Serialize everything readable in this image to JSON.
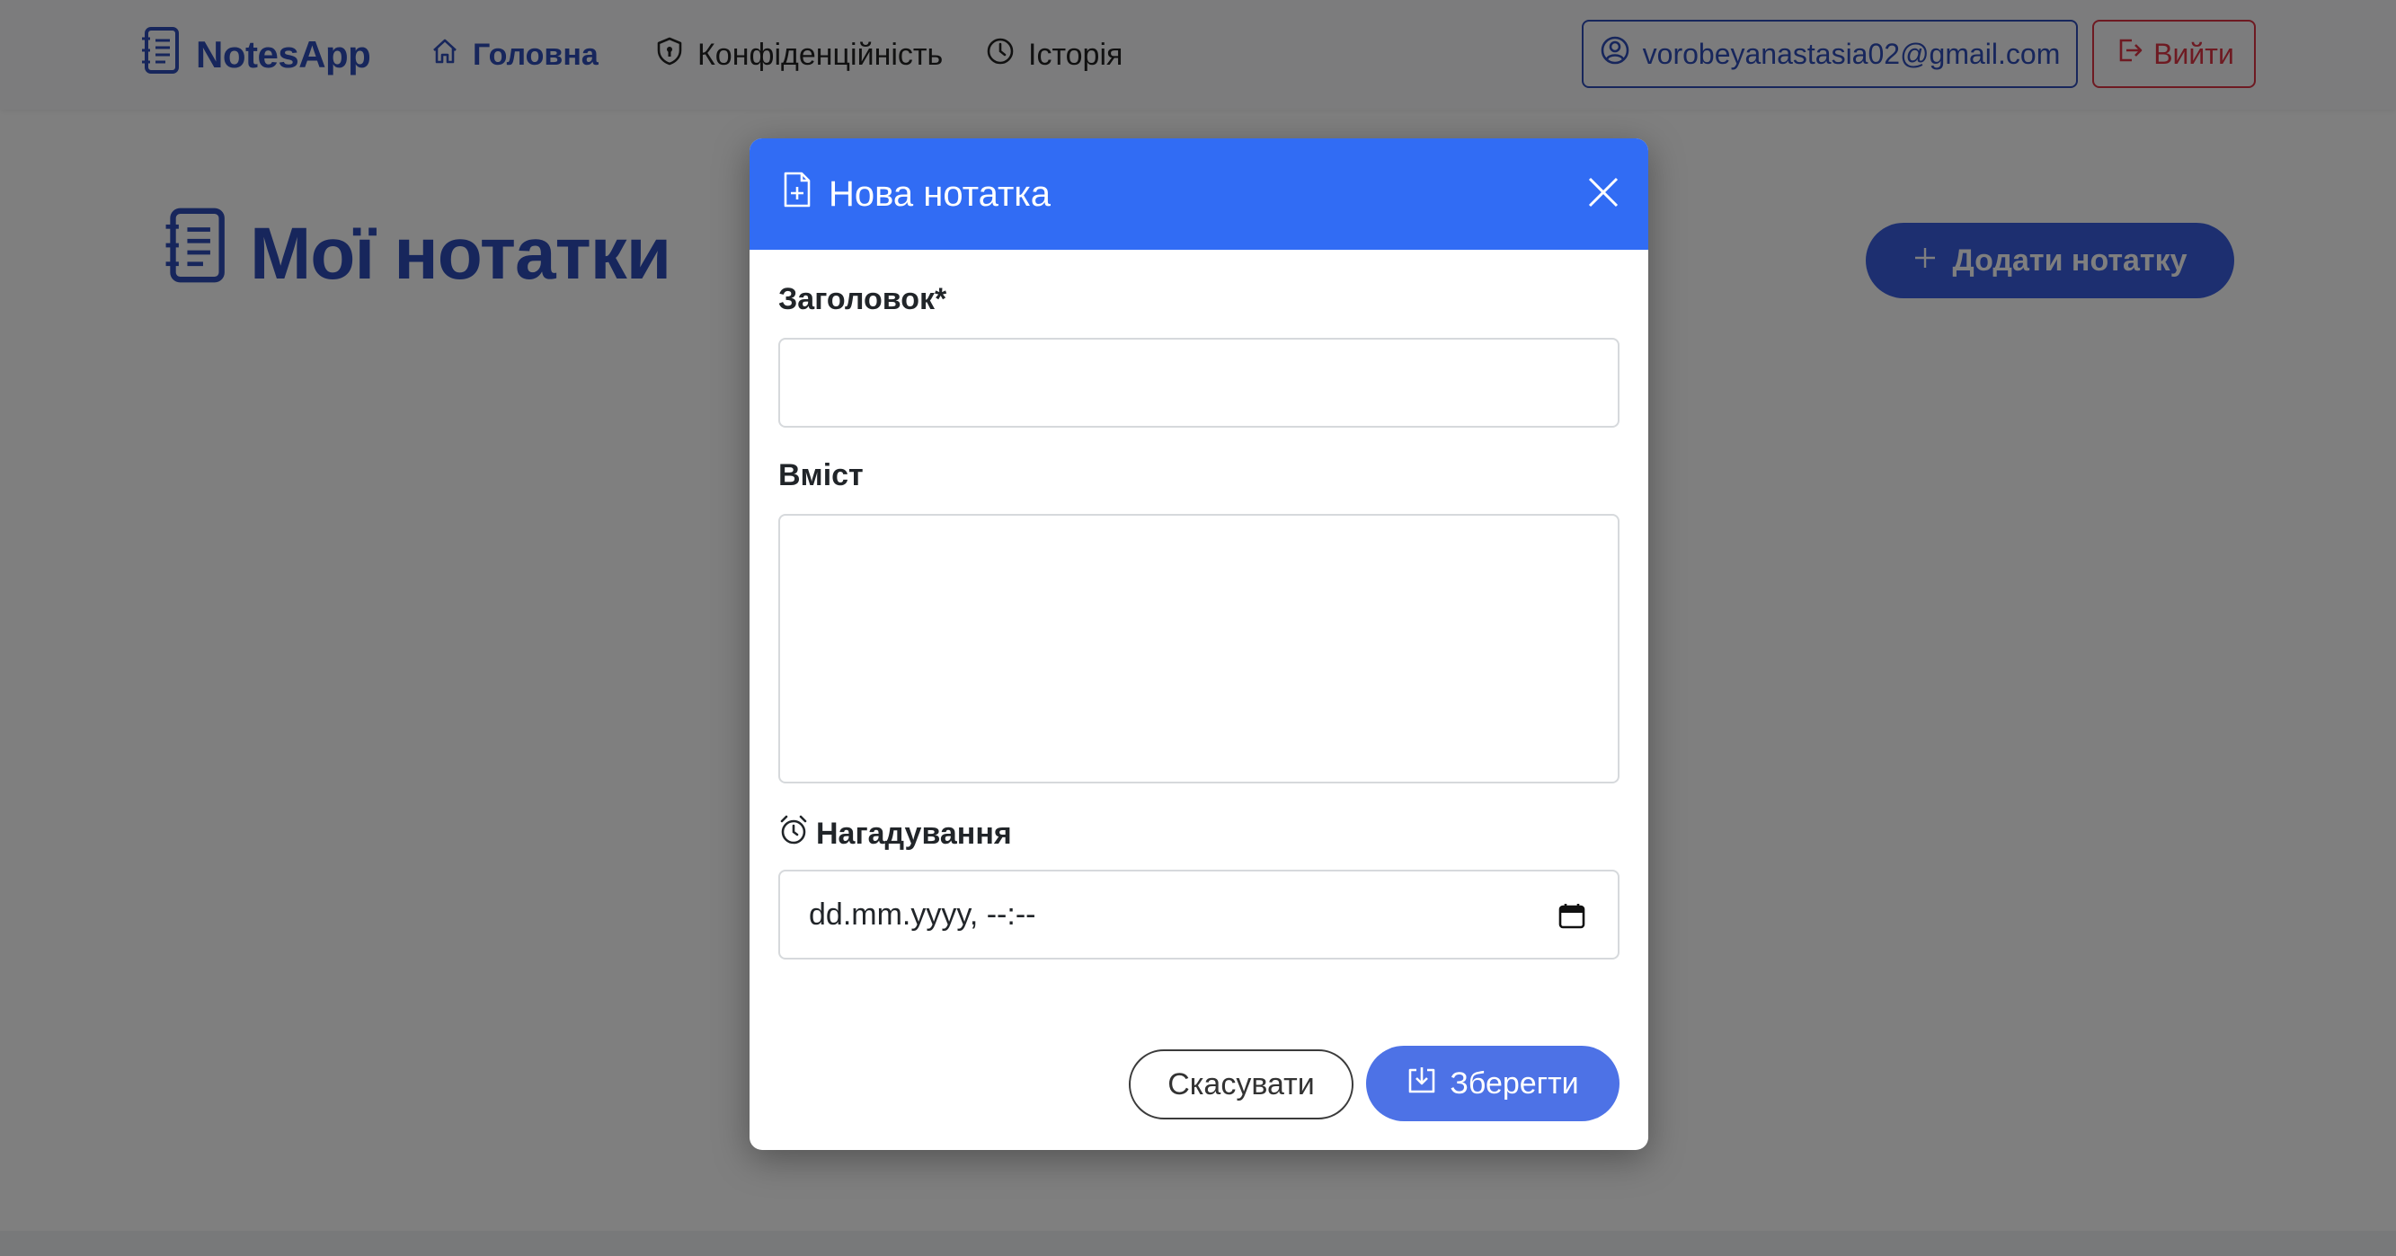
{
  "navbar": {
    "brand": "NotesApp",
    "links": [
      {
        "label": "Головна",
        "icon": "home-icon",
        "active": true
      },
      {
        "label": "Конфіденційність",
        "icon": "shield-icon",
        "active": false
      },
      {
        "label": "Історія",
        "icon": "clock-icon",
        "active": false
      }
    ],
    "user_email": "vorobeyanastasia02@gmail.com",
    "logout_label": "Вийти"
  },
  "page": {
    "title": "Мої нотатки",
    "add_button_label": "Додати нотатку"
  },
  "modal": {
    "title": "Нова нотатка",
    "fields": {
      "title_label": "Заголовок*",
      "title_value": "",
      "content_label": "Вміст",
      "content_value": "",
      "reminder_label": "Нагадування",
      "reminder_value": "dd.mm.yyyy, --:--"
    },
    "cancel_label": "Скасувати",
    "save_label": "Зберегти"
  },
  "colors": {
    "brand": "#2f4db8",
    "modal_header": "#316cf4",
    "save_button": "#4d72e6",
    "danger": "#dc3545"
  }
}
